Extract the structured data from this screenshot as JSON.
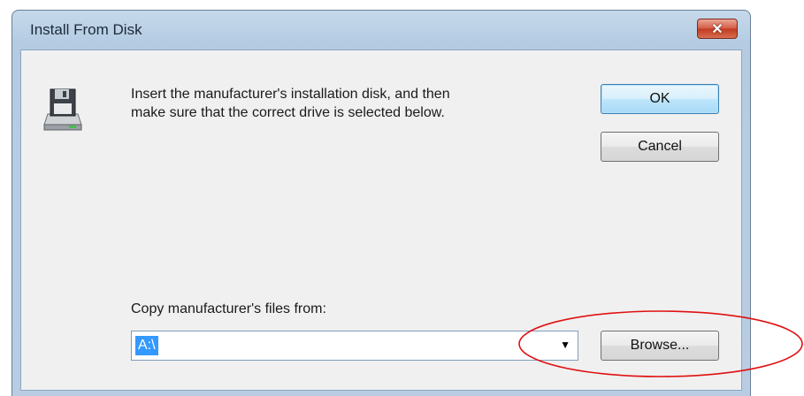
{
  "window": {
    "title": "Install From Disk",
    "close_icon": "close-icon"
  },
  "message": {
    "line1": "Insert the manufacturer's installation disk, and then",
    "line2": "make sure that the correct drive is selected below.",
    "icon": "floppy-disk-icon"
  },
  "buttons": {
    "ok": "OK",
    "cancel": "Cancel",
    "browse": "Browse..."
  },
  "copy_from": {
    "label": "Copy manufacturer's files from:",
    "value": "A:\\"
  },
  "colors": {
    "selection": "#3399ff",
    "annotation": "#e01010"
  }
}
